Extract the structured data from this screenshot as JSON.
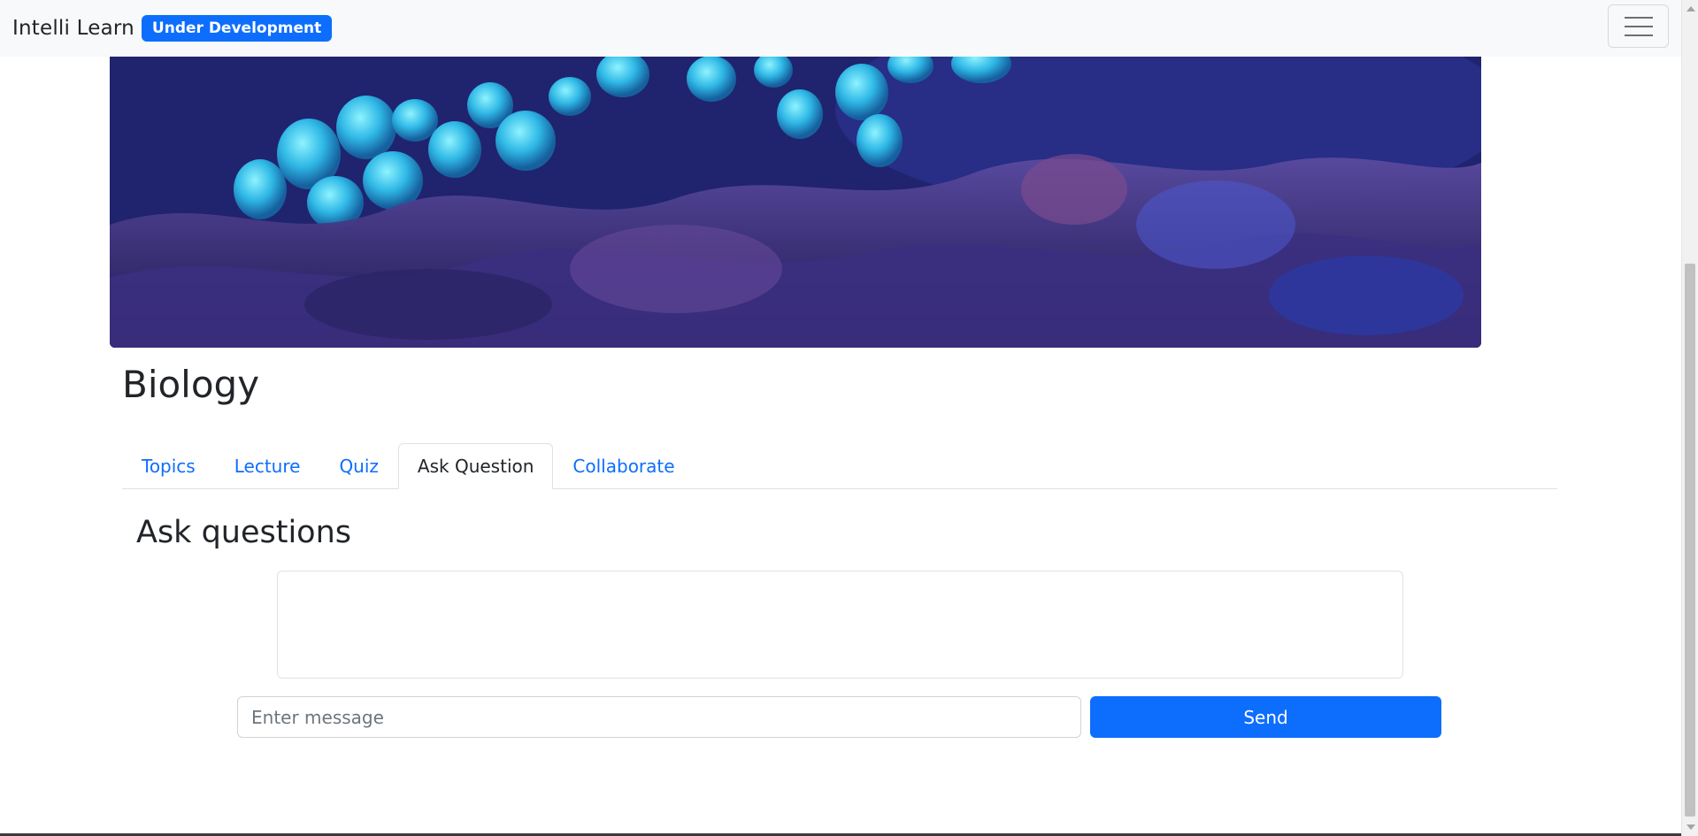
{
  "navbar": {
    "brand": "Intelli Learn",
    "badge": "Under Development",
    "toggler_icon": "hamburger-menu-icon"
  },
  "hero": {
    "description_image": "coral-reef-banner"
  },
  "course": {
    "title": "Biology"
  },
  "tabs": [
    {
      "label": "Topics",
      "active": false
    },
    {
      "label": "Lecture",
      "active": false
    },
    {
      "label": "Quiz",
      "active": false
    },
    {
      "label": "Ask Question",
      "active": true
    },
    {
      "label": "Collaborate",
      "active": false
    }
  ],
  "ask": {
    "heading": "Ask questions",
    "chat_history": "",
    "input_placeholder": "Enter message",
    "input_value": "",
    "send_label": "Send"
  },
  "colors": {
    "primary": "#0d6efd",
    "navbar_bg": "#f8f9fa"
  }
}
